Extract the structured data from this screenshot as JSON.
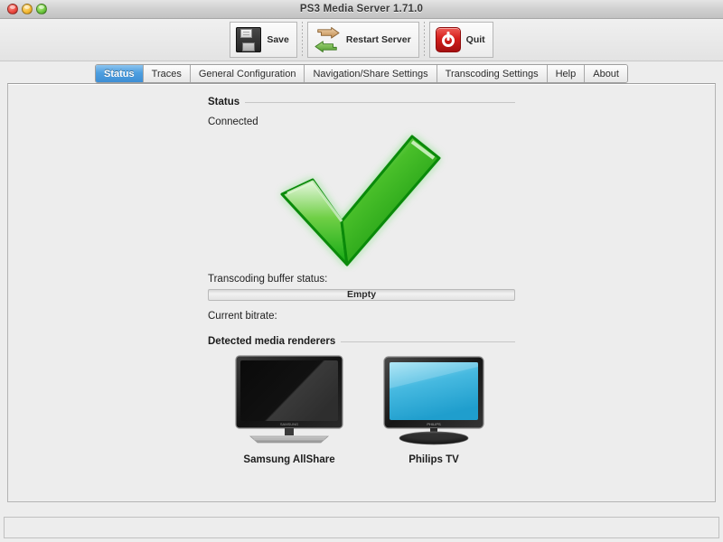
{
  "window": {
    "title": "PS3 Media Server 1.71.0",
    "traffic_lights": [
      "close",
      "minimize",
      "zoom"
    ]
  },
  "toolbar": {
    "buttons": [
      {
        "label": "Save",
        "icon": "floppy-disk-icon"
      },
      {
        "label": "Restart Server",
        "icon": "restart-arrows-icon"
      },
      {
        "label": "Quit",
        "icon": "power-button-icon"
      }
    ]
  },
  "tabs": [
    {
      "label": "Status",
      "active": true
    },
    {
      "label": "Traces",
      "active": false
    },
    {
      "label": "General Configuration",
      "active": false
    },
    {
      "label": "Navigation/Share Settings",
      "active": false
    },
    {
      "label": "Transcoding Settings",
      "active": false
    },
    {
      "label": "Help",
      "active": false
    },
    {
      "label": "About",
      "active": false
    }
  ],
  "status_panel": {
    "section_title": "Status",
    "connection_state": "Connected",
    "status_icon": "green-checkmark-icon",
    "buffer_label": "Transcoding buffer status:",
    "buffer_value": "Empty",
    "buffer_percent": 0,
    "bitrate_label": "Current bitrate:",
    "bitrate_value": "",
    "renderers_title": "Detected media renderers",
    "renderers": [
      {
        "name": "Samsung AllShare",
        "icon": "tv-black-screen-icon"
      },
      {
        "name": "Philips TV",
        "icon": "tv-blue-screen-icon"
      }
    ]
  },
  "statusbar": {
    "text": ""
  },
  "colors": {
    "accent_tab": "#4e9fe0",
    "check_green": "#19b219",
    "quit_red": "#d41f1c",
    "window_bg": "#ededed"
  }
}
